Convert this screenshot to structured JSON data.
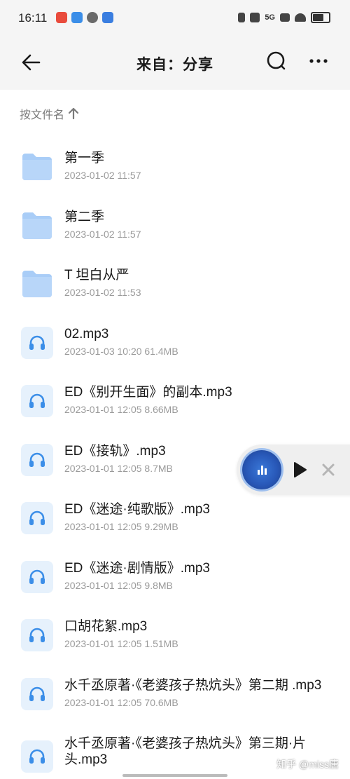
{
  "status_bar": {
    "time": "16:11",
    "network": "5G"
  },
  "header": {
    "title": "来自：分享"
  },
  "sort": {
    "label": "按文件名"
  },
  "files": [
    {
      "type": "folder",
      "name": "第一季",
      "meta": "2023-01-02 11:57"
    },
    {
      "type": "folder",
      "name": "第二季",
      "meta": "2023-01-02 11:57"
    },
    {
      "type": "folder",
      "name": "T 坦白从严",
      "meta": "2023-01-02 11:53"
    },
    {
      "type": "audio",
      "name": "02.mp3",
      "meta": "2023-01-03 10:20  61.4MB"
    },
    {
      "type": "audio",
      "name": "ED《别开生面》的副本.mp3",
      "meta": "2023-01-01 12:05  8.66MB"
    },
    {
      "type": "audio",
      "name": "ED《接轨》.mp3",
      "meta": "2023-01-01 12:05  8.7MB"
    },
    {
      "type": "audio",
      "name": "ED《迷途·纯歌版》.mp3",
      "meta": "2023-01-01 12:05  9.29MB"
    },
    {
      "type": "audio",
      "name": "ED《迷途·剧情版》.mp3",
      "meta": "2023-01-01 12:05  9.8MB"
    },
    {
      "type": "audio",
      "name": "口胡花絮.mp3",
      "meta": "2023-01-01 12:05  1.51MB"
    },
    {
      "type": "audio",
      "name": "水千丞原著·《老婆孩子热炕头》第二期 .mp3",
      "meta": "2023-01-01 12:05  70.6MB"
    },
    {
      "type": "audio",
      "name": "水千丞原著·《老婆孩子热炕头》第三期·片头.mp3",
      "meta": ""
    }
  ],
  "watermark": "知乎 @miss唐",
  "colors": {
    "accent": "#2f6ad0",
    "folder": "#a9cdf7",
    "audio_bg": "#e6f1fc",
    "audio_icon": "#3b8ee8"
  }
}
